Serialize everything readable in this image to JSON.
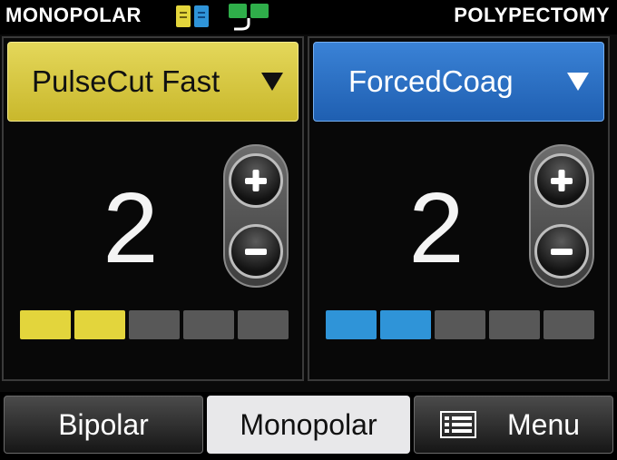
{
  "header": {
    "mode": "MONOPOLAR",
    "program": "POLYPECTOMY",
    "pedal_icon": "pedal-indicator-icon",
    "footswitch_icon": "footswitch-icon"
  },
  "cut": {
    "mode_label": "PulseCut Fast",
    "level": "2",
    "max_level": 5,
    "active_segments": 2,
    "color": "#e3d53c"
  },
  "coag": {
    "mode_label": "ForcedCoag",
    "level": "2",
    "max_level": 5,
    "active_segments": 2,
    "color": "#2f94d8"
  },
  "nav": {
    "bipolar_label": "Bipolar",
    "monopolar_label": "Monopolar",
    "menu_label": "Menu",
    "active": "monopolar"
  },
  "colors": {
    "cut_accent": "#e3d53c",
    "coag_accent": "#2f94d8",
    "inactive_segment": "#585858"
  }
}
